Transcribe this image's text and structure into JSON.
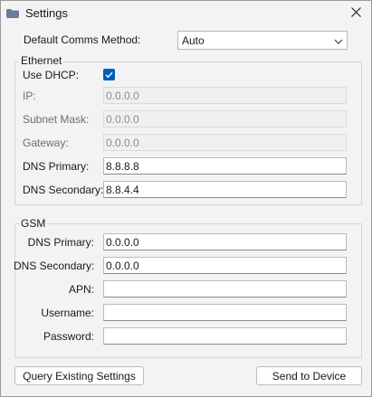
{
  "window": {
    "title": "Settings",
    "close_icon": "close-icon",
    "app_icon": "folder-icon"
  },
  "comms": {
    "label": "Default Comms Method:",
    "selected": "Auto"
  },
  "ethernet": {
    "group_title": "Ethernet",
    "use_dhcp_label": "Use DHCP:",
    "use_dhcp_checked": true,
    "ip_label": "IP:",
    "ip_value": "0.0.0.0",
    "subnet_label": "Subnet Mask:",
    "subnet_value": "0.0.0.0",
    "gateway_label": "Gateway:",
    "gateway_value": "0.0.0.0",
    "dns_primary_label": "DNS Primary:",
    "dns_primary_value": "8.8.8.8",
    "dns_secondary_label": "DNS Secondary:",
    "dns_secondary_value": "8.8.4.4"
  },
  "gsm": {
    "group_title": "GSM",
    "dns_primary_label": "DNS Primary:",
    "dns_primary_value": "0.0.0.0",
    "dns_secondary_label": "DNS Secondary:",
    "dns_secondary_value": "0.0.0.0",
    "apn_label": "APN:",
    "apn_value": "",
    "username_label": "Username:",
    "username_value": "",
    "password_label": "Password:",
    "password_value": ""
  },
  "buttons": {
    "query_label": "Query Existing Settings",
    "send_label": "Send to Device"
  },
  "colors": {
    "accent": "#005fb8",
    "background": "#f3f3f3"
  }
}
